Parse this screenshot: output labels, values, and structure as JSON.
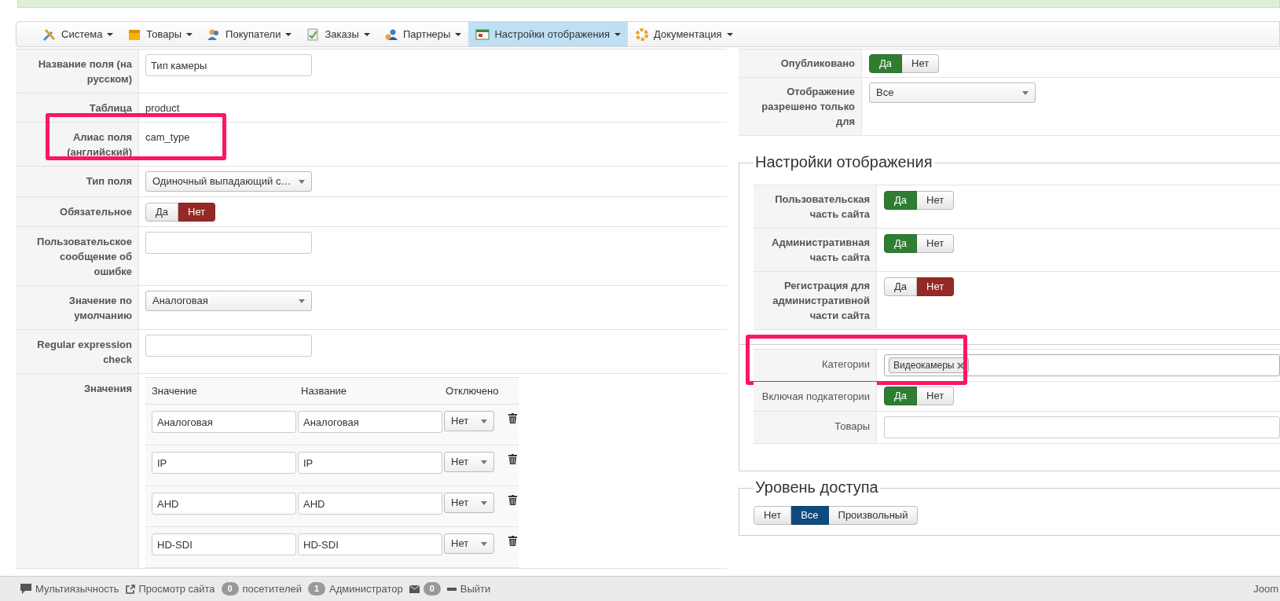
{
  "navbar": {
    "items": [
      {
        "label": "Система",
        "selected": false
      },
      {
        "label": "Товары",
        "selected": false
      },
      {
        "label": "Покупатели",
        "selected": false
      },
      {
        "label": "Заказы",
        "selected": false
      },
      {
        "label": "Партнеры",
        "selected": false
      },
      {
        "label": "Настройки отображения",
        "selected": true
      },
      {
        "label": "Документация",
        "selected": false
      }
    ]
  },
  "field_form": {
    "rows": [
      {
        "label": "Название поля (на русском)",
        "kind": "input",
        "value": "Тип камеры"
      },
      {
        "label": "Таблица",
        "kind": "text",
        "value": "product"
      },
      {
        "label": "Алиас поля (английский)",
        "kind": "text",
        "value": "cam_type",
        "highlighted": true
      },
      {
        "label": "Тип поля",
        "kind": "select",
        "value": "Одиночный выпадающий с…"
      },
      {
        "label": "Обязательное",
        "kind": "toggle",
        "options": [
          {
            "label": "Да",
            "kind": "yes",
            "selected": false
          },
          {
            "label": "Нет",
            "kind": "no",
            "selected": true
          }
        ]
      },
      {
        "label": "Пользовательское сообщение об ошибке",
        "kind": "input",
        "value": ""
      },
      {
        "label": "Значение по умолчанию",
        "kind": "select",
        "value": "Аналоговая"
      },
      {
        "label": "Regular expression check",
        "kind": "input",
        "value": ""
      },
      {
        "label": "Значения",
        "kind": "values",
        "columns": [
          "Значение",
          "Название",
          "Отключено"
        ],
        "rows": [
          {
            "value": "Аналоговая",
            "name": "Аналоговая",
            "disabled": "Нет"
          },
          {
            "value": "IP",
            "name": "IP",
            "disabled": "Нет"
          },
          {
            "value": "AHD",
            "name": "AHD",
            "disabled": "Нет"
          },
          {
            "value": "HD-SDI",
            "name": "HD-SDI",
            "disabled": "Нет"
          }
        ]
      }
    ]
  },
  "publish_form": {
    "rows": [
      {
        "label": "Опубликовано",
        "kind": "toggle",
        "options": [
          {
            "label": "Да",
            "kind": "yes",
            "selected": true
          },
          {
            "label": "Нет",
            "kind": "no",
            "selected": false
          }
        ]
      },
      {
        "label": "Отображение разрешено только для",
        "kind": "select",
        "value": "Все"
      }
    ]
  },
  "display_settings": {
    "legend": "Настройки отображения",
    "rows": [
      {
        "label": "Пользовательская часть сайта",
        "options": [
          {
            "label": "Да",
            "kind": "yes",
            "selected": true
          },
          {
            "label": "Нет",
            "kind": "no",
            "selected": false
          }
        ]
      },
      {
        "label": "Административная часть сайта",
        "options": [
          {
            "label": "Да",
            "kind": "yes",
            "selected": true
          },
          {
            "label": "Нет",
            "kind": "no",
            "selected": false
          }
        ]
      },
      {
        "label": "Регистрация для административной части сайта",
        "options": [
          {
            "label": "Да",
            "kind": "yes",
            "selected": false
          },
          {
            "label": "Нет",
            "kind": "no",
            "selected": true
          }
        ]
      }
    ],
    "filter_rows": [
      {
        "label": "Категории",
        "kind": "tags",
        "tags": [
          "Видеокамеры"
        ],
        "highlighted": true
      },
      {
        "label": "Включая подкатегории",
        "kind": "toggle",
        "options": [
          {
            "label": "Да",
            "kind": "yes",
            "selected": true
          },
          {
            "label": "Нет",
            "kind": "no",
            "selected": false
          }
        ]
      },
      {
        "label": "Товары",
        "kind": "input",
        "value": ""
      }
    ]
  },
  "access_level": {
    "legend": "Уровень доступа",
    "options": [
      {
        "label": "Нет",
        "kind": "choice",
        "selected": false
      },
      {
        "label": "Все",
        "kind": "choice",
        "selected": true
      },
      {
        "label": "Произвольный",
        "kind": "choice",
        "selected": false
      }
    ]
  },
  "status_bar": {
    "items": [
      {
        "kind": "link",
        "label": "Мультиязычность"
      },
      {
        "kind": "link",
        "label": "Просмотр сайта"
      },
      {
        "kind": "badge",
        "count": "0",
        "label": "посетителей"
      },
      {
        "kind": "badge",
        "count": "1",
        "label": "Администратор"
      },
      {
        "kind": "mail",
        "count": "0"
      },
      {
        "kind": "link",
        "label": "Выйти"
      }
    ],
    "right_text": "Joom"
  }
}
